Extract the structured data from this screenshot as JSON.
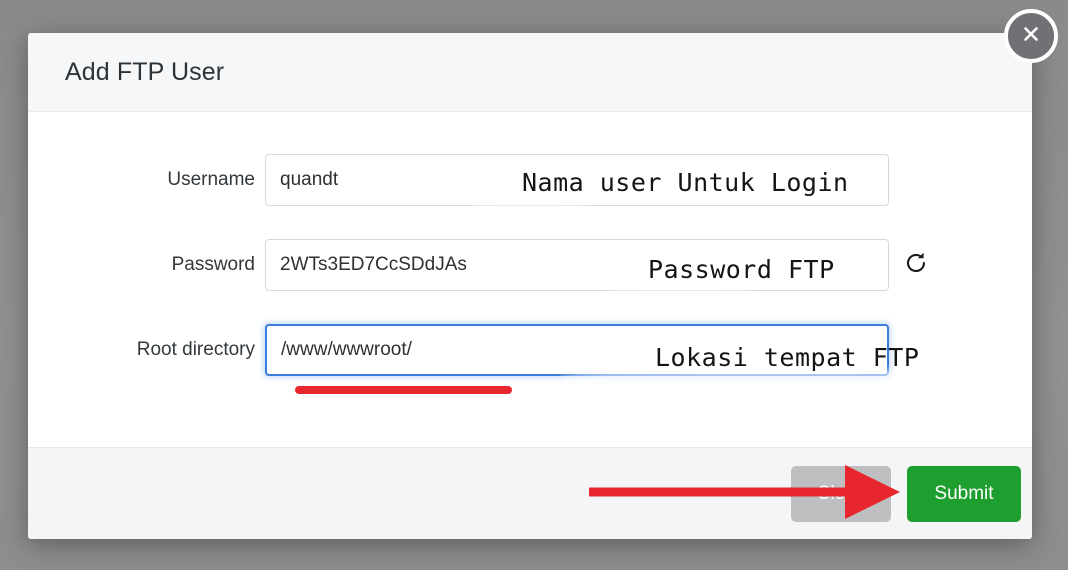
{
  "dialog": {
    "title": "Add FTP User",
    "close_icon": "close-x-icon"
  },
  "form": {
    "fields": [
      {
        "label": "Username",
        "value": "quandt",
        "placeholder": "",
        "focused": false,
        "has_refresh": false
      },
      {
        "label": "Password",
        "value": "2WTs3ED7CcSDdJAs",
        "placeholder": "",
        "focused": false,
        "has_refresh": true,
        "refresh_icon": "refresh-icon"
      },
      {
        "label": "Root directory",
        "value": "/www/wwwroot/",
        "placeholder": "",
        "focused": true,
        "has_refresh": false
      }
    ]
  },
  "footer": {
    "close_label": "Close",
    "submit_label": "Submit"
  },
  "annotations": [
    {
      "text": "Nama user Untuk Login",
      "target": "username"
    },
    {
      "text": "Password FTP",
      "target": "password"
    },
    {
      "text": "Lokasi tempat FTP",
      "target": "root-directory"
    }
  ],
  "markup": {
    "underline_target": "root-directory-input",
    "arrow_target": "submit-button"
  },
  "colors": {
    "submit_green": "#1e9e2e",
    "close_gray": "#bdbfc1",
    "annotation_red": "#e8262d",
    "focus_blue": "#3b7ddd",
    "backdrop": "#8e8e8e",
    "header_bg": "#f6f7f8",
    "footer_bg": "#f4f5f7"
  }
}
